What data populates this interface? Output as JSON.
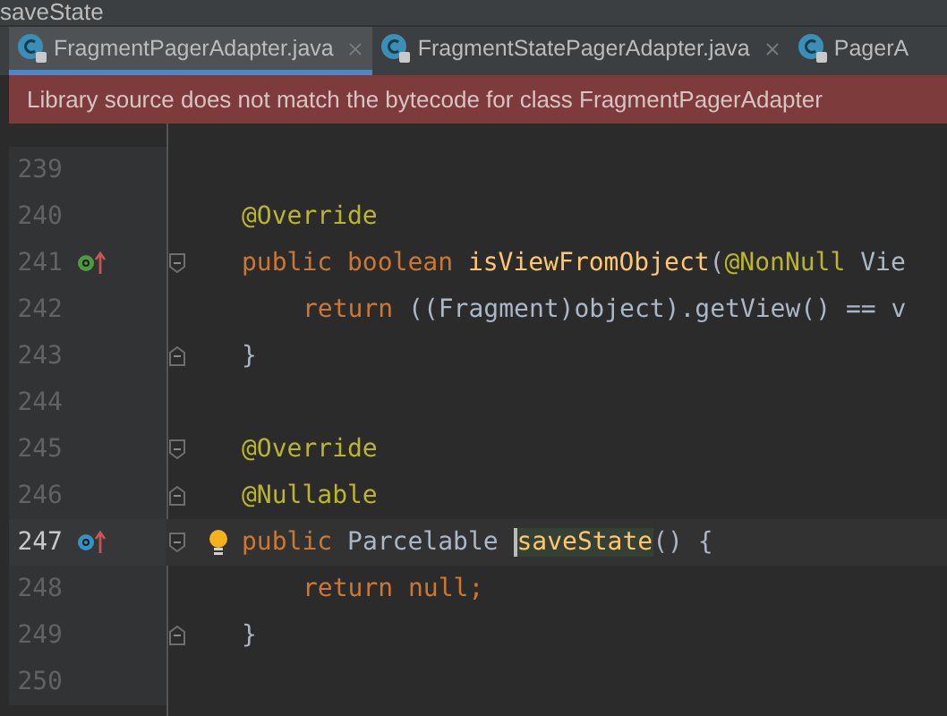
{
  "window": {
    "title": "saveState"
  },
  "tabs": [
    {
      "label": "FragmentPagerAdapter.java",
      "selected": true,
      "closable": true
    },
    {
      "label": "FragmentStatePagerAdapter.java",
      "selected": false,
      "closable": true
    },
    {
      "label": "PagerA",
      "selected": false,
      "closable": false
    }
  ],
  "banner": {
    "text": "Library source does not match the bytecode for class FragmentPagerAdapter"
  },
  "lines": [
    {
      "number": "239"
    },
    {
      "number": "240",
      "tokens": [
        {
          "text": "@Override",
          "kind": "annotation"
        }
      ]
    },
    {
      "number": "241",
      "implements": true,
      "fold_start": true,
      "tokens": [
        {
          "text": "public boolean ",
          "kind": "keyword"
        },
        {
          "text": "isViewFromObject",
          "kind": "method"
        },
        {
          "text": "(",
          "kind": "plain"
        },
        {
          "text": "@NonNull",
          "kind": "annotation"
        },
        {
          "text": " Vie",
          "kind": "plain"
        }
      ]
    },
    {
      "number": "242",
      "indented": true,
      "tokens": [
        {
          "text": "return ",
          "kind": "keyword"
        },
        {
          "text": "((Fragment)object).getView() == v",
          "kind": "plain"
        }
      ]
    },
    {
      "number": "243",
      "fold_end": true,
      "tokens": [
        {
          "text": "}",
          "kind": "plain"
        }
      ]
    },
    {
      "number": "244"
    },
    {
      "number": "245",
      "fold_start": true,
      "tokens": [
        {
          "text": "@Override",
          "kind": "annotation"
        }
      ]
    },
    {
      "number": "246",
      "fold_end": true,
      "tokens": [
        {
          "text": "@Nullable",
          "kind": "annotation"
        }
      ]
    },
    {
      "number": "247",
      "current": true,
      "bulb": true,
      "overrides": true,
      "fold_start": true,
      "tokens": [
        {
          "text": "public ",
          "kind": "keyword"
        },
        {
          "text": "Parcelable ",
          "kind": "plain"
        },
        {
          "text": "saveState",
          "kind": "highlighted"
        },
        {
          "text": "() {",
          "kind": "plain"
        }
      ]
    },
    {
      "number": "248",
      "indented": true,
      "tokens": [
        {
          "text": "return null;",
          "kind": "keyword"
        }
      ]
    },
    {
      "number": "249",
      "fold_end": true,
      "tokens": [
        {
          "text": "}",
          "kind": "plain"
        }
      ]
    },
    {
      "number": "250"
    }
  ]
}
